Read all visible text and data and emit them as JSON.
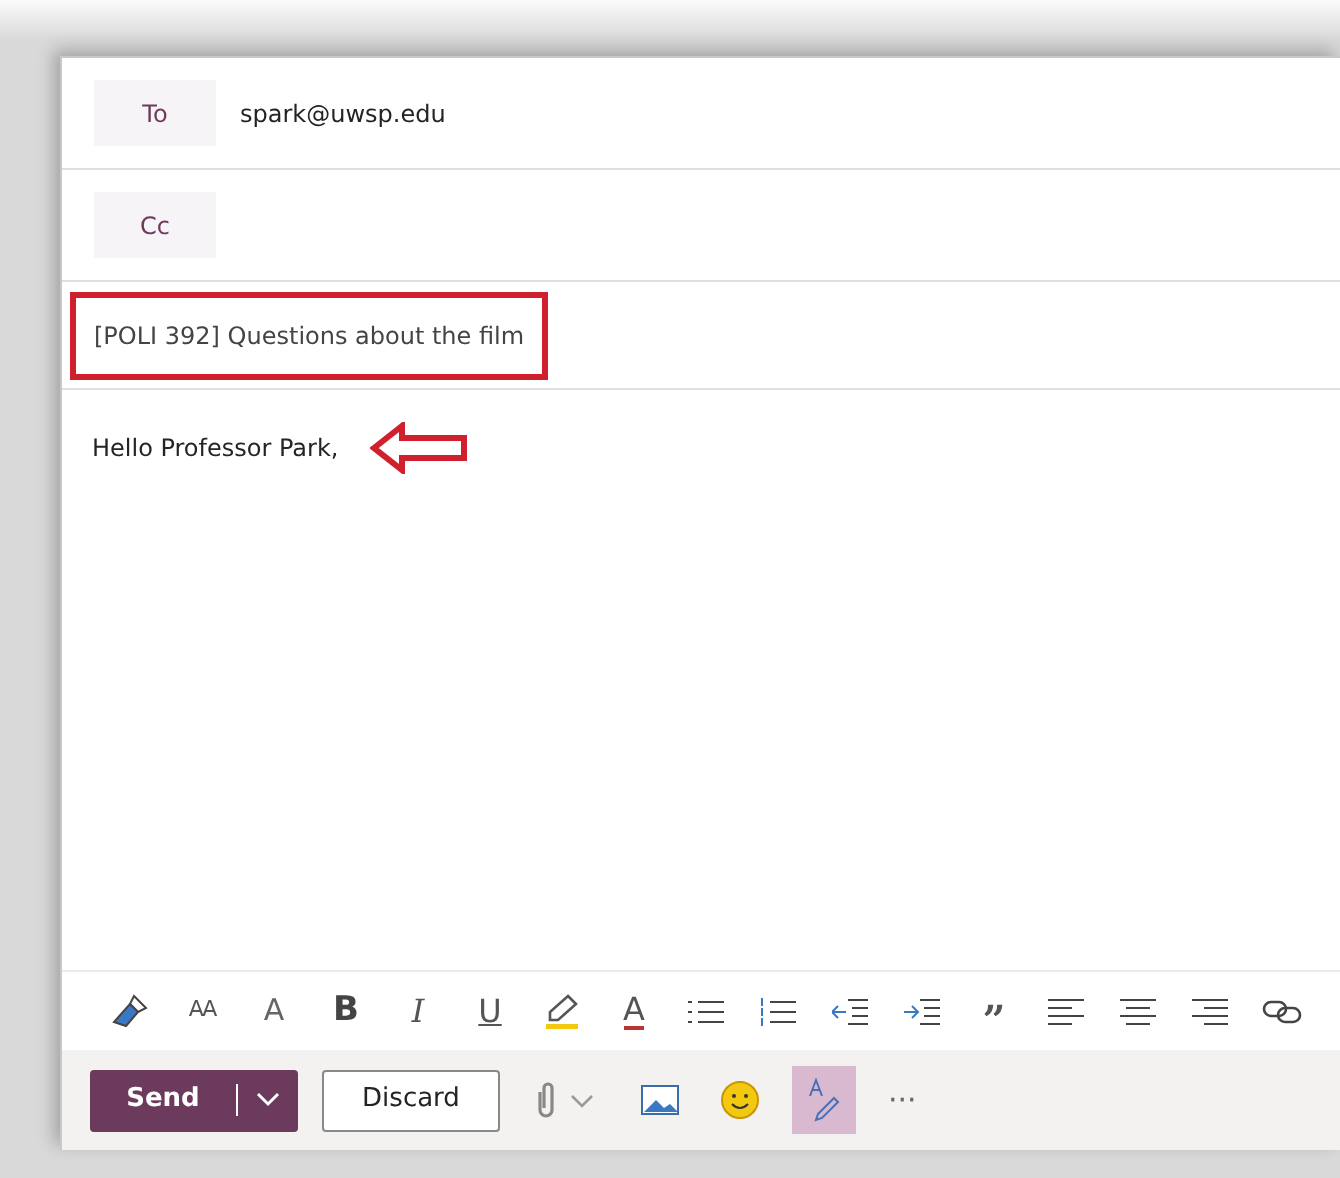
{
  "recipients": [
    {
      "label": "To",
      "value": "spark@uwsp.edu"
    },
    {
      "label": "Cc"
    }
  ],
  "subject": "[POLI 392] Questions about the film",
  "body": "Hello Professor Park,",
  "format_toolbar": [
    {
      "kind": "painter"
    },
    {
      "kind": "size",
      "glyph": "AA"
    },
    {
      "kind": "case",
      "glyph": "A"
    },
    {
      "kind": "bold",
      "glyph": "B"
    },
    {
      "kind": "italic",
      "glyph": "I"
    },
    {
      "kind": "underline",
      "glyph": "U"
    },
    {
      "kind": "highlighter"
    },
    {
      "kind": "color",
      "glyph": "A"
    },
    {
      "kind": "bullets"
    },
    {
      "kind": "numbering"
    },
    {
      "kind": "outdent"
    },
    {
      "kind": "indent"
    },
    {
      "kind": "quote",
      "glyph": "”"
    },
    {
      "kind": "align-left"
    },
    {
      "kind": "align-center"
    },
    {
      "kind": "align-right"
    },
    {
      "kind": "link"
    }
  ],
  "actions": {
    "send": "Send",
    "discard": "Discard",
    "more": "···",
    "spellcheck_selected": true
  }
}
